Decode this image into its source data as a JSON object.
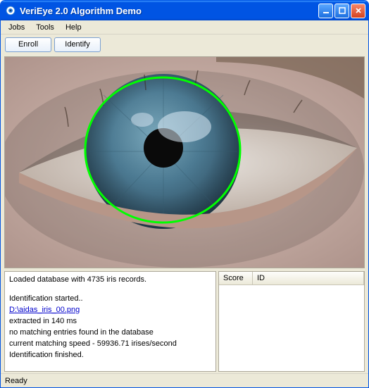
{
  "window": {
    "title": "VeriEye 2.0 Algorithm Demo"
  },
  "menubar": {
    "jobs": "Jobs",
    "tools": "Tools",
    "help": "Help"
  },
  "toolbar": {
    "enroll": "Enroll",
    "identify": "Identify"
  },
  "log": {
    "line1": "Loaded database with 4735 iris records.",
    "line2": "Identification started..",
    "file": "D:\\aidas_iris_00.png",
    "line3": "extracted in 140 ms",
    "line4": "no matching entries found in the database",
    "line5": "current matching speed - 59936.71 irises/second",
    "line6": "Identification finished."
  },
  "results": {
    "col_score": "Score",
    "col_id": "ID"
  },
  "status": {
    "text": "Ready"
  },
  "colors": {
    "overlay": "#00ff00"
  }
}
